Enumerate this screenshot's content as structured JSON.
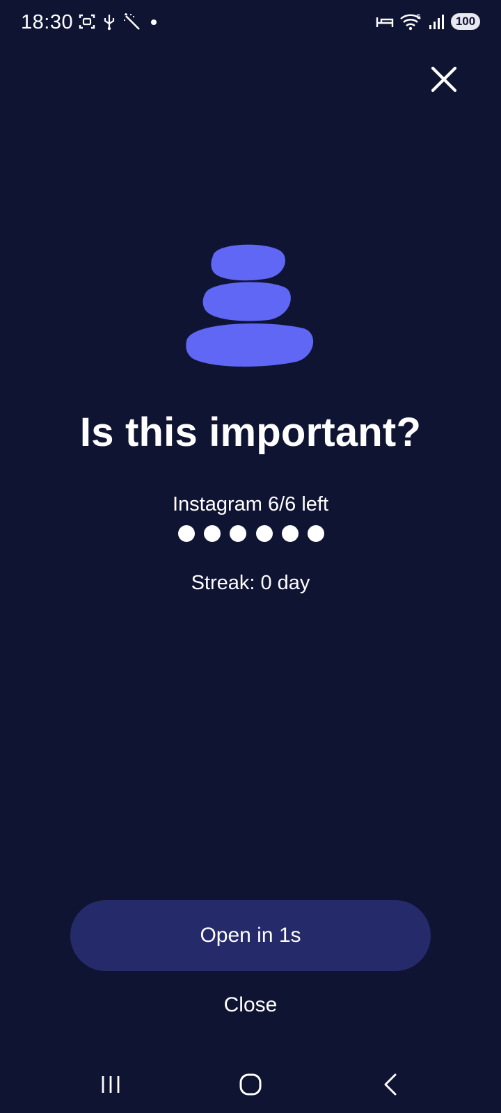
{
  "status_bar": {
    "time": "18:30",
    "battery": "100",
    "icons_left": [
      "screenshot-icon",
      "usb-icon",
      "magic-wand-icon",
      "notification-dot-icon"
    ],
    "icons_right": [
      "bed-icon",
      "wifi-icon",
      "signal-icon",
      "battery-icon"
    ]
  },
  "main": {
    "title": "Is this important?",
    "app_count": "Instagram 6/6 left",
    "remaining_opens": 6,
    "total_opens": 6,
    "streak": "Streak: 0 day"
  },
  "actions": {
    "open_label": "Open in 1s",
    "close_label": "Close"
  },
  "colors": {
    "background": "#101433",
    "accent": "#5f67f4",
    "button": "#252a6b",
    "text": "#ffffff"
  },
  "nav": [
    "recent-apps-icon",
    "home-icon",
    "back-icon"
  ]
}
